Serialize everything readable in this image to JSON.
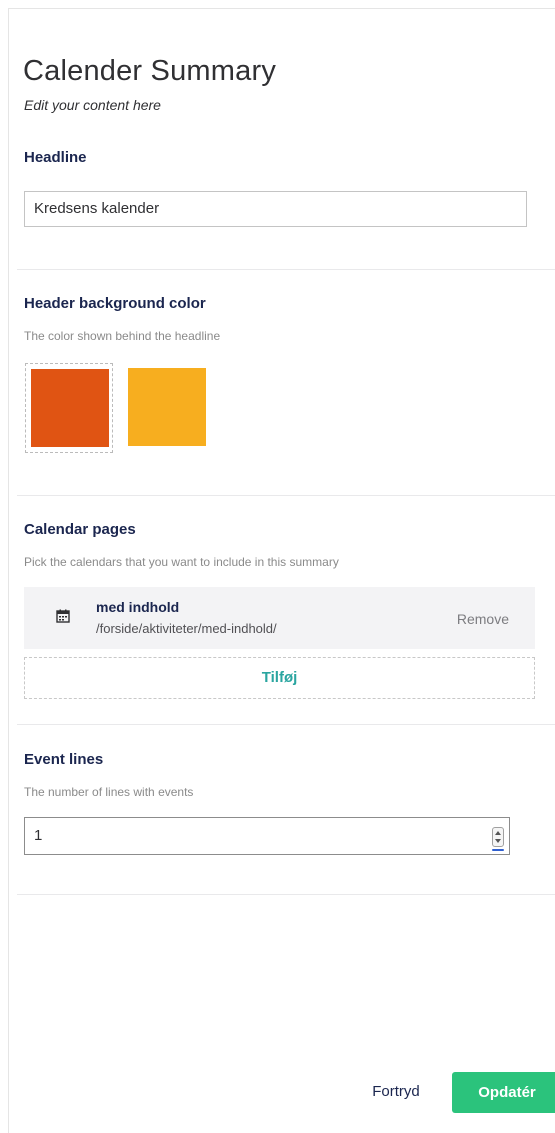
{
  "header": {
    "title": "Calender Summary",
    "subtitle": "Edit your content here"
  },
  "headline": {
    "label": "Headline",
    "value": "Kredsens kalender"
  },
  "header_color": {
    "label": "Header background color",
    "description": "The color shown behind the headline",
    "swatches": [
      {
        "color": "#e05413",
        "selected": true
      },
      {
        "color": "#f7ae1f",
        "selected": false
      }
    ]
  },
  "calendar_pages": {
    "label": "Calendar pages",
    "description": "Pick the calendars that you want to include in this summary",
    "items": [
      {
        "name": "med indhold",
        "path": "/forside/aktiviteter/med-indhold/",
        "remove_label": "Remove",
        "icon": "calendar-icon"
      }
    ],
    "add_label": "Tilføj"
  },
  "event_lines": {
    "label": "Event lines",
    "description": "The number of lines with events",
    "value": "1"
  },
  "footer": {
    "cancel_label": "Fortryd",
    "submit_label": "Opdatér"
  },
  "colors": {
    "accent": "#2bc37c",
    "link_teal": "#2aa5a0",
    "text_dark": "#1b264f"
  }
}
